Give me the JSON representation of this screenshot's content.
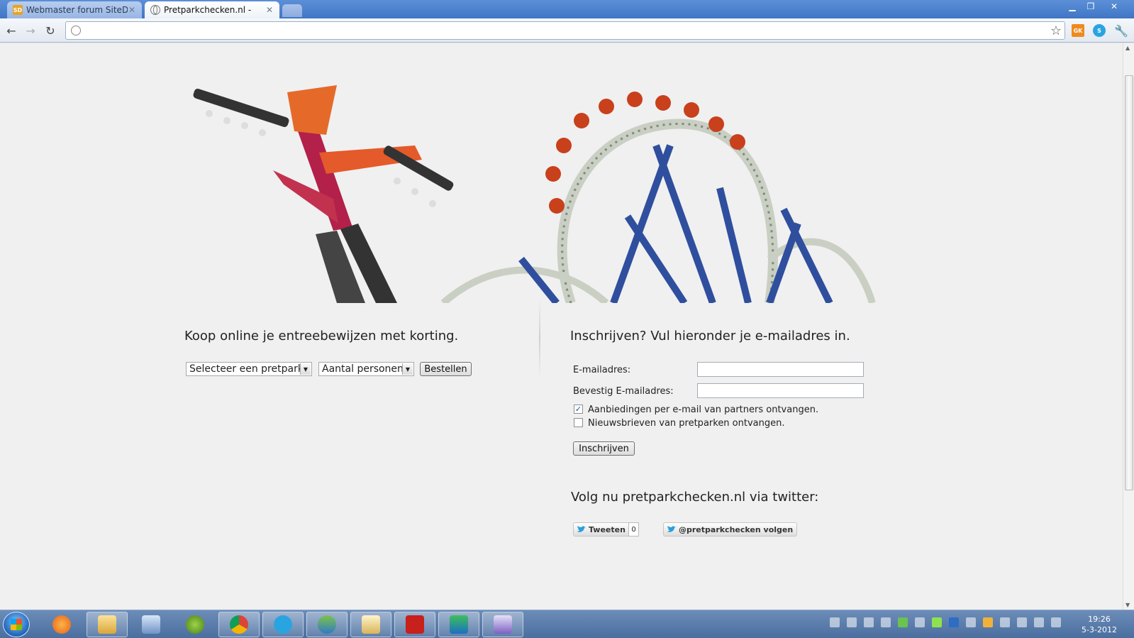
{
  "browser": {
    "tabs": [
      {
        "title": "Webmaster forum SiteDeals",
        "favicon": "sitedeals-icon",
        "active": false
      },
      {
        "title": "Pretparkchecken.nl -",
        "favicon": "globe-icon",
        "active": true
      }
    ],
    "window_controls": [
      "minimize",
      "restore",
      "close"
    ],
    "address": "",
    "extensions": [
      "GK",
      "skype"
    ]
  },
  "page": {
    "tickets": {
      "heading": "Koop online je entreebewijzen met korting.",
      "park_select": "Selecteer een pretpark",
      "persons_select": "Aantal personen",
      "order_button": "Bestellen"
    },
    "signup": {
      "heading": "Inschrijven? Vul hieronder je e-mailadres in.",
      "email_label": "E-mailadres:",
      "confirm_label": "Bevestig E-mailadres:",
      "email_value": "",
      "confirm_value": "",
      "offers_label": "Aanbiedingen per e-mail van partners ontvangen.",
      "offers_checked": true,
      "newsletter_label": "Nieuwsbrieven van pretparken ontvangen.",
      "newsletter_checked": false,
      "submit_button": "Inschrijven"
    },
    "twitter": {
      "heading": "Volg nu pretparkchecken.nl via twitter:",
      "tweet_button": "Tweeten",
      "tweet_count": "0",
      "follow_button": "@pretparkchecken volgen"
    }
  },
  "taskbar": {
    "apps": [
      "media-player",
      "explorer",
      "network-tool",
      "gadget",
      "chrome",
      "skype",
      "messenger",
      "mail",
      "filezilla",
      "editor",
      "visual-studio"
    ],
    "active_app": "chrome",
    "clock": {
      "time": "19:26",
      "date": "5-3-2012"
    }
  },
  "colors": {
    "twitter_blue": "#2a9fd8",
    "taskbar": "#4a6e9f",
    "page_bg": "#f0f0f0"
  }
}
